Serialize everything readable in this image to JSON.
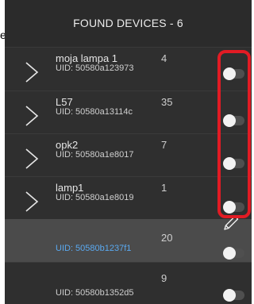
{
  "background_fragment": "e",
  "header": {
    "title": "FOUND DEVICES - 6"
  },
  "devices": [
    {
      "name": "moja lampa 1",
      "uid": "UID: 50580a123973",
      "count": "4"
    },
    {
      "name": "L57",
      "uid": "UID: 50580a13114c",
      "count": "35"
    },
    {
      "name": "opk2",
      "uid": "UID: 50580a1e8017",
      "count": "7"
    },
    {
      "name": "lamp1",
      "uid": "UID: 50580a1e8019",
      "count": "1"
    },
    {
      "name": "",
      "uid": "UID: 50580b1237f1",
      "count": "20"
    },
    {
      "name": "",
      "uid": "UID: 50580b1352d5",
      "count": "9"
    }
  ],
  "icons": {
    "expand": "chevron-right-icon",
    "toggle": "toggle-switch-icon",
    "edit": "pencil-icon"
  },
  "colors": {
    "panel": "#2c2c2c",
    "row": "#2f2f2f",
    "selected_row": "#4b4b4b",
    "uid_highlight": "#5aa9f0",
    "annotation": "#e21b24"
  }
}
